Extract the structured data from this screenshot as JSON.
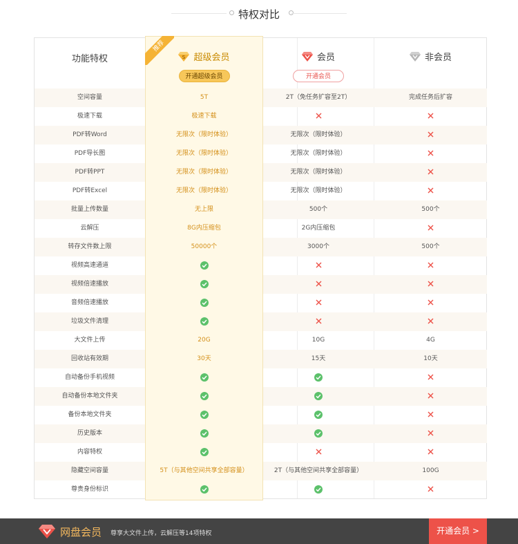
{
  "page_title": "特权对比",
  "ribbon": "推荐",
  "header": {
    "feature_label": "功能特权",
    "super": {
      "name": "超级会员",
      "badge": "S",
      "button": "开通超级会员"
    },
    "member": {
      "name": "会员",
      "button": "开通会员"
    },
    "non_member": {
      "name": "非会员"
    }
  },
  "rows": [
    {
      "feature": "空间容量",
      "super": "5T",
      "member": "2T（免任务扩容至2T）",
      "non": "完成任务后扩容"
    },
    {
      "feature": "极速下载",
      "super": "极速下载",
      "member": "x",
      "non": "x"
    },
    {
      "feature": "PDF转Word",
      "super": "无限次（限时体验）",
      "member": "无限次（限时体验）",
      "non": "x"
    },
    {
      "feature": "PDF导长图",
      "super": "无限次（限时体验）",
      "member": "无限次（限时体验）",
      "non": "x"
    },
    {
      "feature": "PDF转PPT",
      "super": "无限次（限时体验）",
      "member": "无限次（限时体验）",
      "non": "x"
    },
    {
      "feature": "PDF转Excel",
      "super": "无限次（限时体验）",
      "member": "无限次（限时体验）",
      "non": "x"
    },
    {
      "feature": "批量上传数量",
      "super": "无上限",
      "member": "500个",
      "non": "500个"
    },
    {
      "feature": "云解压",
      "super": "8G内压缩包",
      "member": "2G内压缩包",
      "non": "x"
    },
    {
      "feature": "转存文件数上限",
      "super": "50000个",
      "member": "3000个",
      "non": "500个"
    },
    {
      "feature": "视频高速通道",
      "super": "check",
      "member": "x",
      "non": "x"
    },
    {
      "feature": "视频倍速播放",
      "super": "check",
      "member": "x",
      "non": "x"
    },
    {
      "feature": "音频倍速播放",
      "super": "check",
      "member": "x",
      "non": "x"
    },
    {
      "feature": "垃圾文件清理",
      "super": "check",
      "member": "x",
      "non": "x"
    },
    {
      "feature": "大文件上传",
      "super": "20G",
      "member": "10G",
      "non": "4G"
    },
    {
      "feature": "回收站有效期",
      "super": "30天",
      "member": "15天",
      "non": "10天"
    },
    {
      "feature": "自动备份手机视频",
      "super": "check",
      "member": "check",
      "non": "x"
    },
    {
      "feature": "自动备份本地文件夹",
      "super": "check",
      "member": "check",
      "non": "x"
    },
    {
      "feature": "备份本地文件夹",
      "super": "check",
      "member": "check",
      "non": "x"
    },
    {
      "feature": "历史版本",
      "super": "check",
      "member": "check",
      "non": "x"
    },
    {
      "feature": "内容特权",
      "super": "check",
      "member": "x",
      "non": "x"
    },
    {
      "feature": "隐藏空间容量",
      "super": "5T（与其他空间共享全部容量）",
      "member": "2T（与其他空间共享全部容量）",
      "non": "100G"
    },
    {
      "feature": "尊贵身份标识",
      "super": "check",
      "member": "check",
      "non": "x"
    }
  ],
  "footer": {
    "title": "网盘会员",
    "description": "尊享大文件上传，云解压等14项特权",
    "button": "开通会员 >"
  },
  "colors": {
    "accent_red": "#ed5249",
    "check_green": "#5cc16b",
    "super_gold": "#f5b335",
    "footer_bg": "#444444"
  }
}
